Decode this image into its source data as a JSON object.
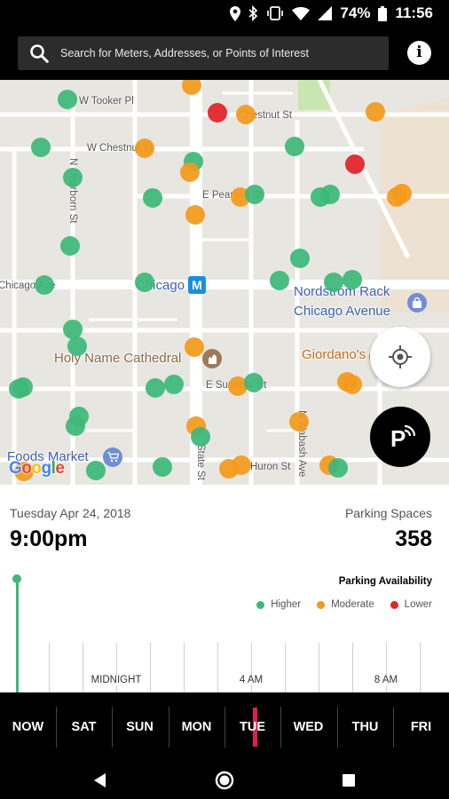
{
  "status_bar": {
    "battery": "74%",
    "time": "11:56"
  },
  "search": {
    "placeholder": "Search for Meters, Addresses, or Points of Interest"
  },
  "icons": {
    "search": "search-icon",
    "info": "info-icon",
    "locate": "crosshair-icon",
    "park": "parking-icon"
  },
  "map": {
    "streets": {
      "tooker": "W Tooker Pl",
      "chestnut": "W Chestnut St",
      "pearson": "E Pearson St",
      "chicago_w": "Chicago Ave",
      "chicago_label": "Chicago",
      "superior": "E Superior St",
      "huron": "Huron St",
      "chestnut_e": "Chestnut St",
      "dearborn": "N Dearborn St",
      "state": "State St",
      "wabash": "N Wabash Ave"
    },
    "pois": {
      "nordstrom_line1": "Nordstrom Rack",
      "nordstrom_line2": "Chicago Avenue",
      "cathedral": "Holy Name Cathedral",
      "giordanos": "Giordano's",
      "foods_market": "Foods Market"
    },
    "subway_glyph": "M",
    "google": "Google",
    "colors": {
      "higher": "#3cb878",
      "moderate": "#f39a1c",
      "lower": "#e0262c"
    }
  },
  "panel": {
    "date": "Tuesday Apr 24, 2018",
    "time": "9:00pm",
    "spaces_label": "Parking Spaces",
    "spaces_value": "358",
    "availability_title": "Parking Availability",
    "legend": {
      "higher": "Higher",
      "moderate": "Moderate",
      "lower": "Lower"
    },
    "timeline_labels": {
      "midnight": "MIDNIGHT",
      "four_am": "4 AM",
      "eight_am": "8 AM"
    }
  },
  "days": [
    "NOW",
    "SAT",
    "SUN",
    "MON",
    "TUE",
    "WED",
    "THU",
    "FRI"
  ],
  "selected_day": "TUE"
}
